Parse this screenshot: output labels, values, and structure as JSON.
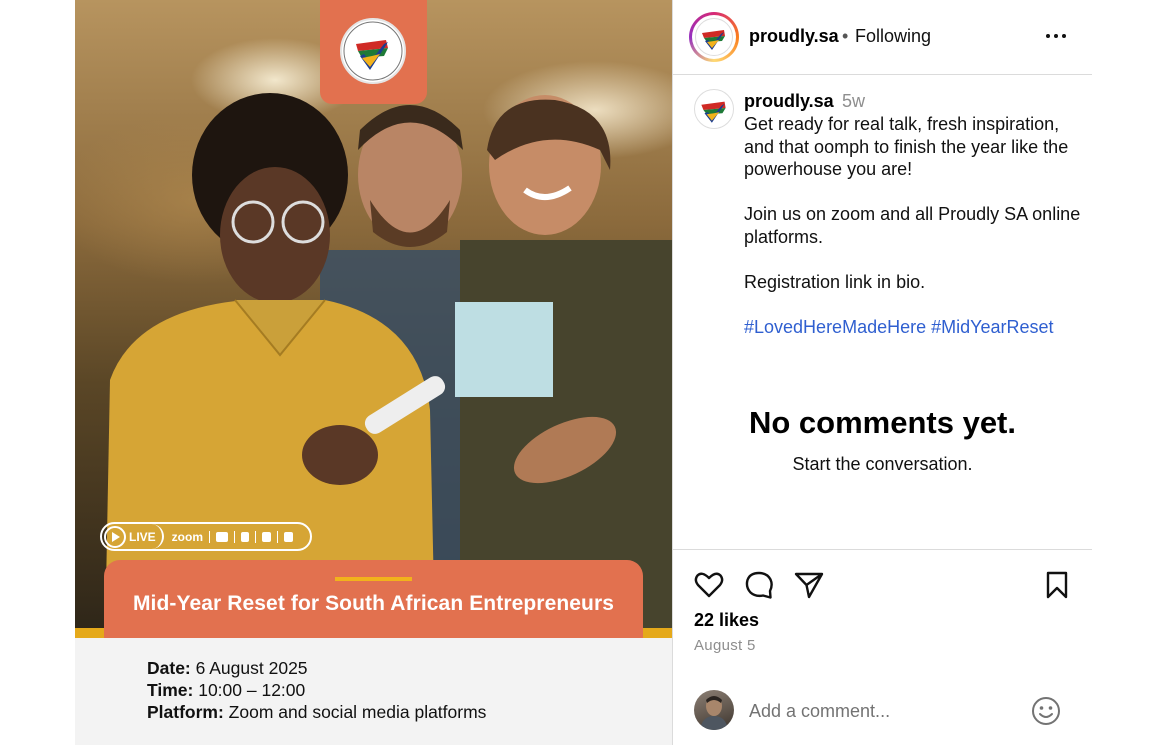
{
  "post_image": {
    "live_label": "LIVE",
    "platforms_label": "zoom",
    "banner_title": "Mid-Year Reset for South African Entrepreneurs",
    "details": [
      {
        "label": "Date:",
        "value": " 6 August 2025"
      },
      {
        "label": "Time:",
        "value": " 10:00 – 12:00"
      },
      {
        "label": "Platform:",
        "value": " Zoom and social media platforms"
      }
    ],
    "colors": {
      "accent": "#e2714f",
      "gold": "#e5a91a",
      "banner_line": "#f2b21c"
    }
  },
  "header": {
    "username": "proudly.sa",
    "separator": "•",
    "follow_status": "Following",
    "more_icon": "more-horizontal-icon"
  },
  "caption": {
    "username": "proudly.sa",
    "time": "5w",
    "paragraphs": [
      "Get ready for real talk, fresh inspiration, and that oomph to finish the year like the powerhouse you are!",
      "Join us on zoom and all Proudly SA online platforms.",
      "Registration link in bio."
    ],
    "hashtags": [
      "#LovedHereMadeHere",
      "#MidYearReset"
    ]
  },
  "comments": {
    "empty_title": "No comments yet.",
    "empty_subtitle": "Start the conversation."
  },
  "actions": {
    "icons": [
      "heart-icon",
      "comment-icon",
      "share-icon",
      "bookmark-icon"
    ],
    "likes": "22 likes",
    "date": "August 5"
  },
  "comment_box": {
    "placeholder": "Add a comment...",
    "emoji_icon": "emoji-icon",
    "hashtag_color": "#2f5fd0"
  }
}
